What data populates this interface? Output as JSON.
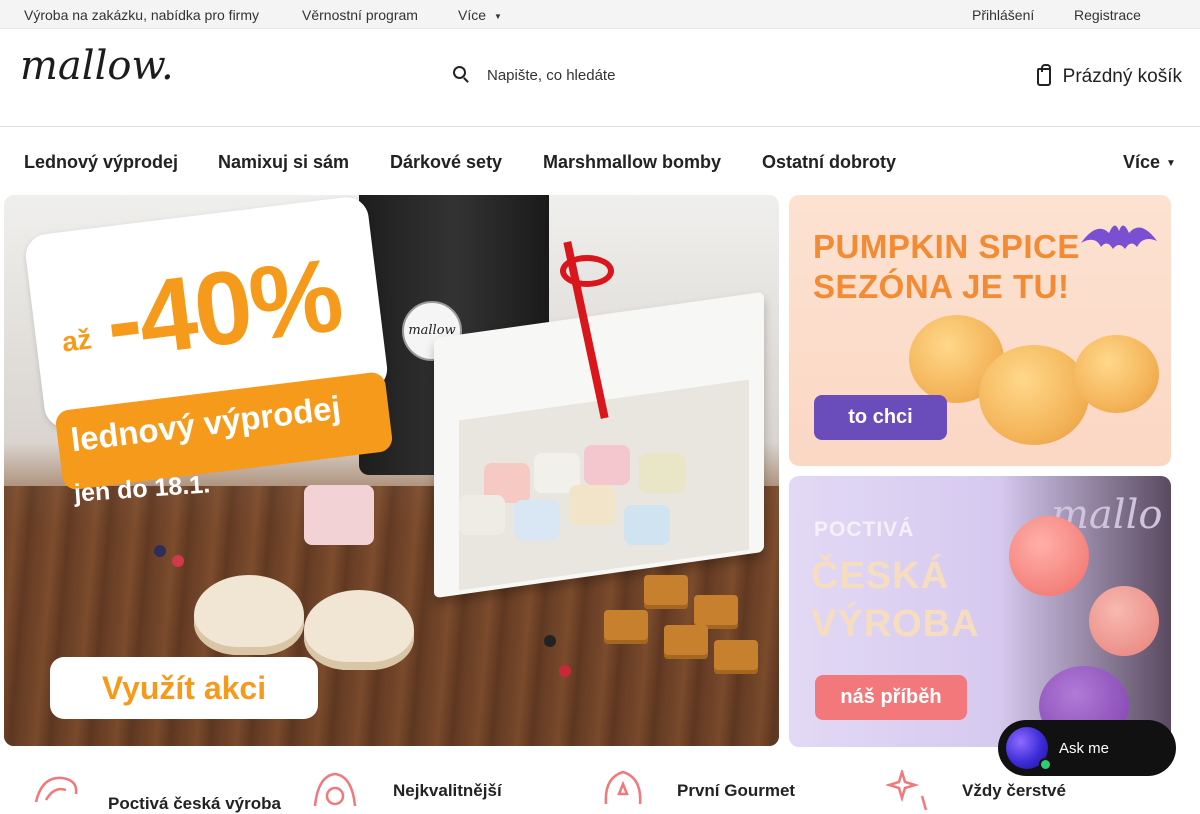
{
  "topbar": {
    "links": [
      "Výroba na zakázku, nabídka pro firmy",
      "Věrnostní program",
      "Více"
    ],
    "login": "Přihlášení",
    "register": "Registrace"
  },
  "header": {
    "logo": "mallow.",
    "search_placeholder": "Napište, co hledáte",
    "cart_label": "Prázdný košík"
  },
  "nav": {
    "items": [
      "Lednový výprodej",
      "Namixuj si sám",
      "Dárkové sety",
      "Marshmallow bomby",
      "Ostatní dobroty"
    ],
    "more": "Více"
  },
  "banners": {
    "main": {
      "prefix": "až",
      "discount": "-40%",
      "headline": "lednový výprodej",
      "until": "jen do 18.1.",
      "bag_logo": "mallow",
      "cta": "Využít akci"
    },
    "pumpkin": {
      "line1": "PUMPKIN SPICE",
      "line2": "SEZÓNA JE TU!",
      "cta": "to chci"
    },
    "czech": {
      "small": "POCTIVÁ",
      "line1": "ČESKÁ",
      "line2": "VÝROBA",
      "cta": "náš příběh",
      "logo": "mallo"
    }
  },
  "chat": {
    "label": "Ask me"
  },
  "features": [
    {
      "text": "Poctivá česká výroba",
      "icon": "hand-heart-icon"
    },
    {
      "text": "Nejkvalitnější",
      "icon": "quality-badge-icon"
    },
    {
      "text": "První Gourmet",
      "icon": "award-badge-icon"
    },
    {
      "text": "Vždy čerstvé",
      "icon": "sparkle-icon"
    }
  ],
  "colors": {
    "accent_orange": "#f59a1b",
    "purple_cta": "#6a4cbb",
    "coral_cta": "#f2787b",
    "chat_bg": "#111111"
  }
}
